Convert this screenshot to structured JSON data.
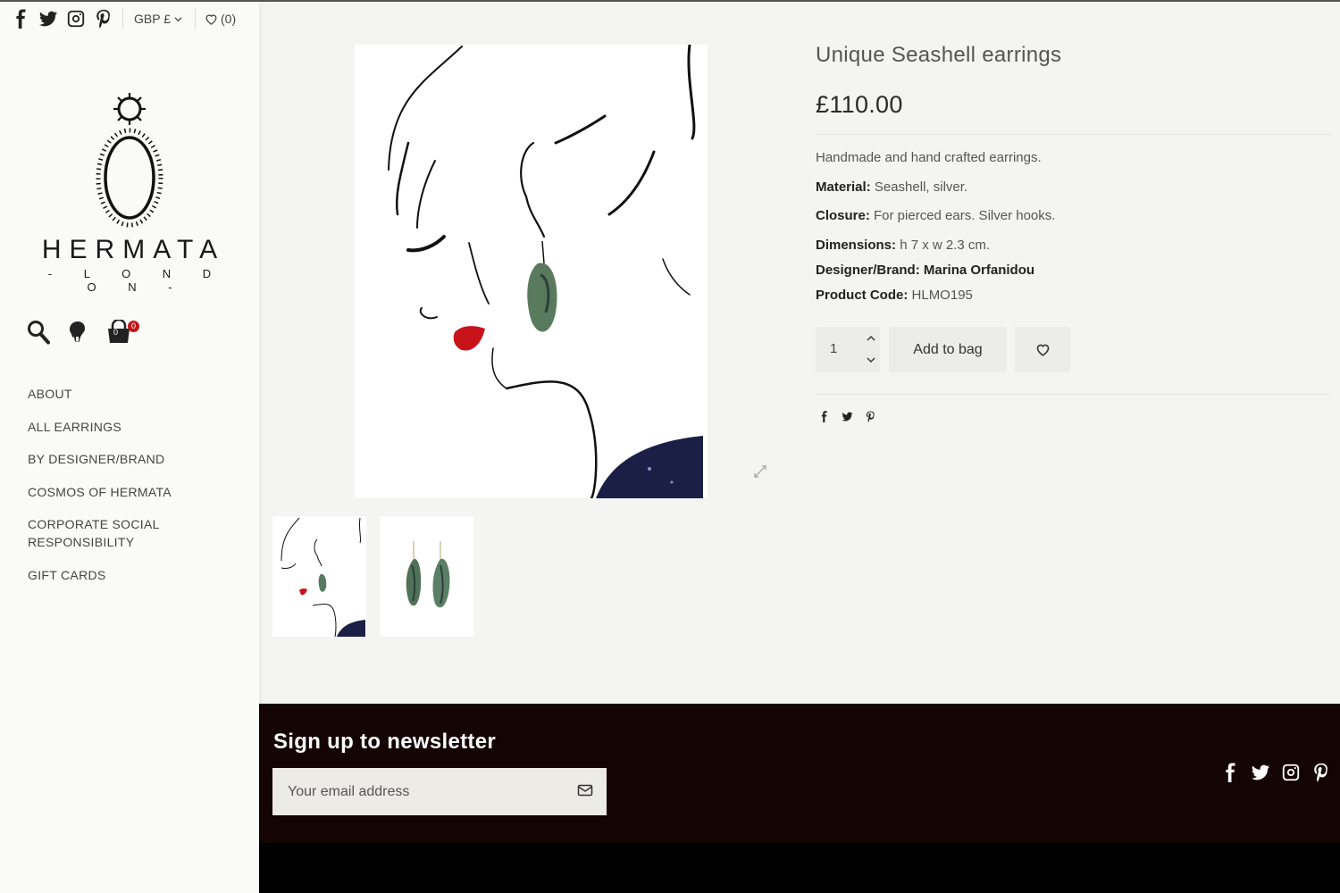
{
  "header": {
    "currency": "GBP £",
    "wishlist": "(0)"
  },
  "brand": {
    "name": "HERMATA",
    "sub": "- L O N D O N -"
  },
  "cart": {
    "count": "0"
  },
  "nav": {
    "items": [
      "ABOUT",
      "ALL EARRINGS",
      "BY DESIGNER/BRAND",
      "COSMOS OF HERMATA",
      "CORPORATE SOCIAL RESPONSIBILITY",
      "GIFT CARDS"
    ]
  },
  "product": {
    "title": "Unique Seashell earrings",
    "price": "£110.00",
    "intro": "Handmade and hand crafted earrings.",
    "material_label": "Material:",
    "material": "Seashell, silver.",
    "closure_label": "Closure:",
    "closure": "For pierced ears. Silver hooks.",
    "dimensions_label": "Dimensions:",
    "dimensions": "h 7 x w 2.3 cm.",
    "designer_label": "Designer/Brand:",
    "designer": "Marina Orfanidou",
    "code_label": "Product Code:",
    "code": "HLMO195",
    "quantity": "1",
    "add_label": "Add to bag"
  },
  "newsletter": {
    "title": "Sign up to newsletter",
    "placeholder": "Your email address"
  },
  "icons": {
    "social": [
      "facebook-icon",
      "twitter-icon",
      "instagram-icon",
      "pinterest-icon"
    ],
    "cart": "shopping-bag-icon",
    "account": "account-icon",
    "search": "search-icon"
  },
  "colors": {
    "footer": "#150404",
    "badge": "#c01818",
    "button_bg": "#ececea"
  }
}
